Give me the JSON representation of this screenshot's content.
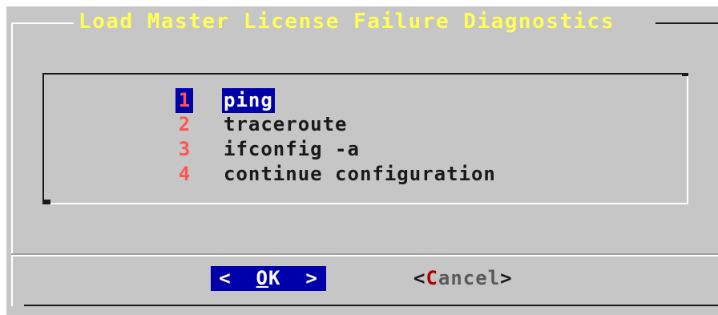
{
  "dialog": {
    "title": "Load Master License Failure Diagnostics"
  },
  "menu": {
    "items": [
      {
        "tag": "1",
        "label": "ping",
        "selected": true
      },
      {
        "tag": "2",
        "label": "traceroute",
        "selected": false
      },
      {
        "tag": "3",
        "label": "ifconfig -a",
        "selected": false
      },
      {
        "tag": "4",
        "label": "continue configuration",
        "selected": false
      }
    ]
  },
  "buttons": {
    "ok": {
      "left_bracket": "<",
      "hotkey": "O",
      "rest": "K",
      "right_bracket": ">"
    },
    "cancel": {
      "left_bracket": "<",
      "hotkey": "C",
      "rest": "ancel",
      "right_bracket": ">"
    }
  },
  "colors": {
    "background": "#c6c6c6",
    "title": "#ffff54",
    "selection": "#0000aa",
    "tag": "#ff5454",
    "hotkey": "#aa0000"
  }
}
